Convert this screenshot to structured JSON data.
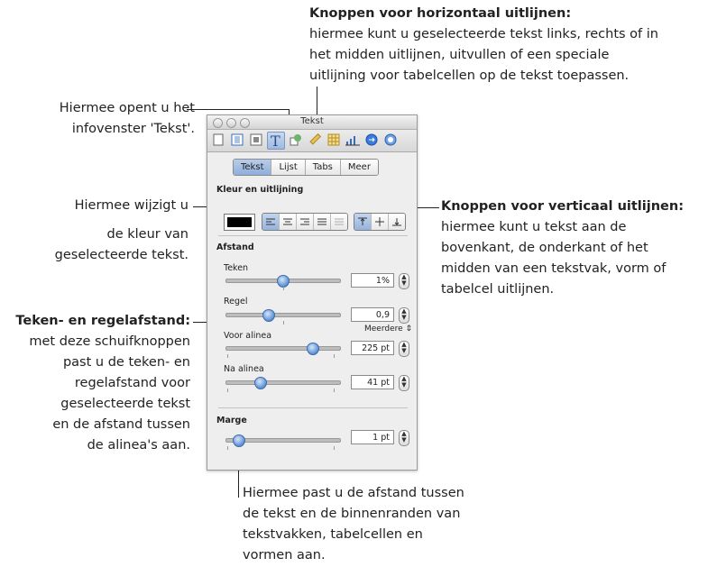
{
  "callouts": {
    "horizontal_title": "Knoppen voor horizontaal uitlijnen:",
    "horizontal_line1": "hiermee kunt u geselecteerde tekst links, rechts of in",
    "horizontal_line2": "het midden uitlijnen, uitvullen of een speciale",
    "horizontal_line3": "uitlijning voor tabelcellen op de tekst toepassen.",
    "infowindow_line1": "Hiermee opent u het",
    "infowindow_line2": "infovenster 'Tekst'.",
    "color_line1": "Hiermee wijzigt u",
    "color_line2": "de kleur van",
    "color_line3": "geselecteerde tekst.",
    "vertical_title": "Knoppen voor verticaal uitlijnen:",
    "vertical_line1": "hiermee kunt u tekst aan de",
    "vertical_line2": "bovenkant, de onderkant of het",
    "vertical_line3": "midden van een tekstvak, vorm of",
    "vertical_line4": "tabelcel uitlijnen.",
    "spacing_title": "Teken- en regelafstand:",
    "spacing_line1": "met deze schuifknoppen",
    "spacing_line2": "past u de teken- en",
    "spacing_line3": "regelafstand voor",
    "spacing_line4": "geselecteerde tekst",
    "spacing_line5": "en de afstand tussen",
    "spacing_line6": "de alinea's aan.",
    "margin_line1": "Hiermee past u de afstand tussen",
    "margin_line2": "de tekst en de binnenranden van",
    "margin_line3": "tekstvakken, tabelcellen en",
    "margin_line4": "vormen aan."
  },
  "panel": {
    "title": "Tekst",
    "toolbar_icons": [
      "document-icon",
      "layout-icon",
      "wrap-icon",
      "text-icon",
      "graphic-icon",
      "metrics-icon",
      "table-icon",
      "chart-icon",
      "link-icon",
      "quicktime-icon"
    ],
    "tabs": [
      "Tekst",
      "Lijst",
      "Tabs",
      "Meer"
    ],
    "active_tab": "Tekst",
    "color_section": "Kleur en uitlijning",
    "color_swatch": "#000000",
    "spacing_section": "Afstand",
    "teken_label": "Teken",
    "teken_value": "1%",
    "regel_label": "Regel",
    "regel_value": "0,9",
    "meerdere_label": "Meerdere",
    "voor_label": "Voor alinea",
    "voor_value": "225 pt",
    "na_label": "Na alinea",
    "na_value": "41 pt",
    "margin_section": "Marge",
    "margin_value": "1 pt"
  }
}
